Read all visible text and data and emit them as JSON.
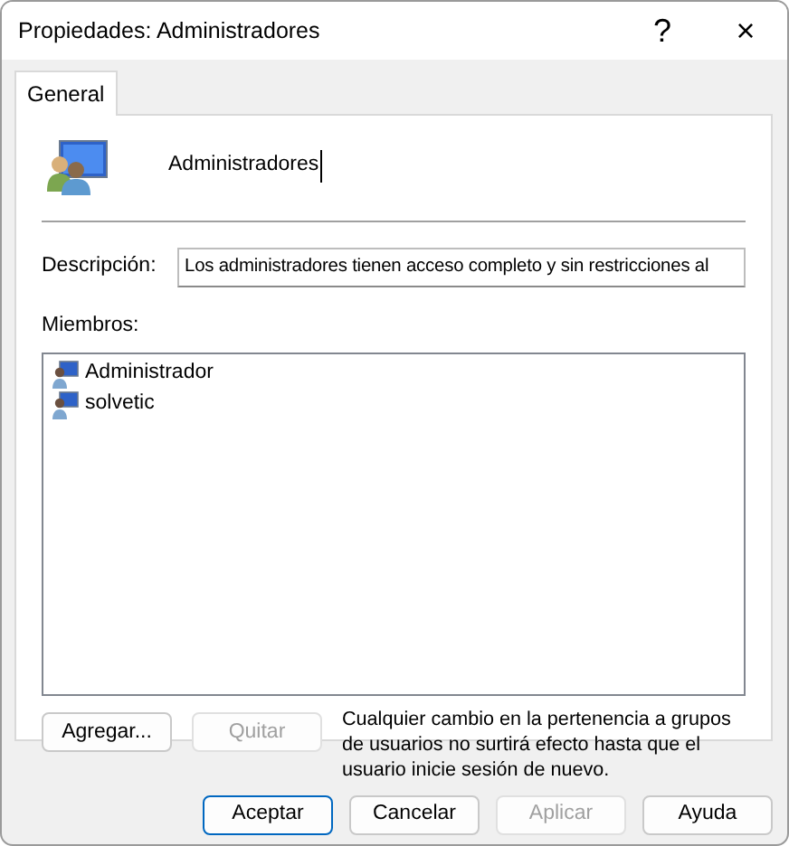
{
  "window": {
    "title": "Propiedades: Administradores",
    "help_button": "?",
    "close_button": "×"
  },
  "tabs": [
    {
      "label": "General",
      "selected": true
    }
  ],
  "group_name": "Administradores",
  "description": {
    "label": "Descripción:",
    "value": "Los administradores tienen acceso completo y sin restricciones al"
  },
  "members": {
    "label": "Miembros:",
    "items": [
      {
        "name": "Administrador",
        "selected": false
      },
      {
        "name": "solvetic",
        "selected": false
      }
    ]
  },
  "member_buttons": [
    {
      "label": "Agregar...",
      "disabled": false
    },
    {
      "label": "Quitar",
      "disabled": true
    }
  ],
  "note": "Cualquier cambio en la pertenencia a grupos de usuarios no surtirá efecto hasta que el usuario inicie sesión de nuevo.",
  "buttons": [
    {
      "label": "Aceptar",
      "default": true,
      "disabled": false
    },
    {
      "label": "Cancelar",
      "default": false,
      "disabled": false
    },
    {
      "label": "Aplicar",
      "default": false,
      "disabled": true
    },
    {
      "label": "Ayuda",
      "default": false,
      "disabled": false
    }
  ]
}
